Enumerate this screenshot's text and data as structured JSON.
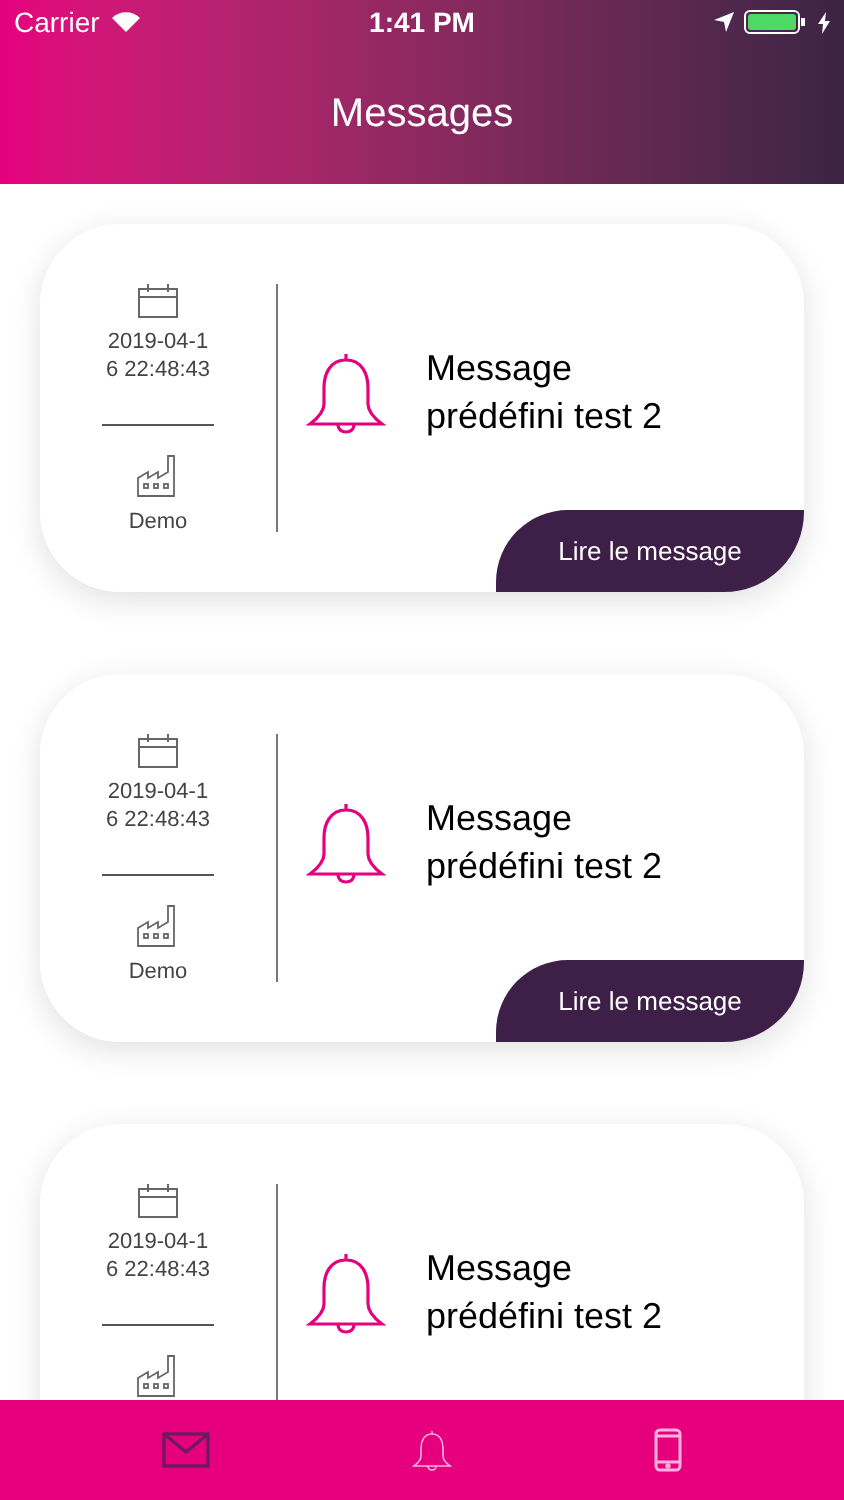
{
  "status_bar": {
    "carrier": "Carrier",
    "time": "1:41 PM"
  },
  "header": {
    "title": "Messages"
  },
  "messages": [
    {
      "date": "2019-04-1\n6 22:48:43",
      "source": "Demo",
      "text": "Message\nprédéfini test 2",
      "button": "Lire le message"
    },
    {
      "date": "2019-04-1\n6 22:48:43",
      "source": "Demo",
      "text": "Message\nprédéfini test 2",
      "button": "Lire le message"
    },
    {
      "date": "2019-04-1\n6 22:48:43",
      "text": "Message\nprédéfini test 2"
    }
  ],
  "tabs": [
    {
      "kind": "mail",
      "selected": true
    },
    {
      "kind": "bell",
      "selected": false
    },
    {
      "kind": "phone",
      "selected": false
    }
  ]
}
